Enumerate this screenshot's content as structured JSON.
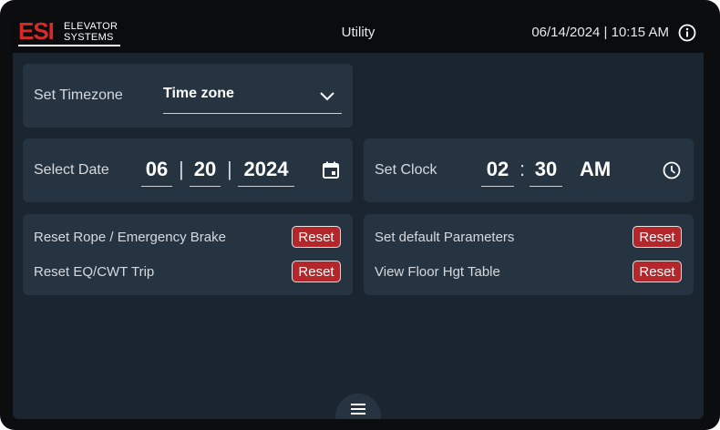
{
  "header": {
    "logo_main": "ESI",
    "logo_line1": "ELEVATOR",
    "logo_line2": "SYSTEMS",
    "title": "Utility",
    "datetime": "06/14/2024 | 10:15 AM",
    "info_icon": "info-icon"
  },
  "timezone": {
    "label": "Set Timezone",
    "value": "Time zone",
    "dropdown_icon": "chevron-down-icon"
  },
  "date": {
    "label": "Select Date",
    "month": "06",
    "day": "20",
    "year": "2024",
    "separator": "|",
    "icon": "calendar-icon"
  },
  "clock": {
    "label": "Set Clock",
    "hour": "02",
    "minute": "30",
    "separator": ":",
    "period": "AM",
    "icon": "clock-icon"
  },
  "resets_left": [
    {
      "label": "Reset Rope / Emergency Brake",
      "button": "Reset"
    },
    {
      "label": "Reset EQ/CWT Trip",
      "button": "Reset"
    }
  ],
  "resets_right": [
    {
      "label": "Set default Parameters",
      "button": "Reset"
    },
    {
      "label": "View Floor Hgt Table",
      "button": "Reset"
    }
  ],
  "menu": {
    "icon": "hamburger-menu-icon"
  },
  "colors": {
    "brand_red": "#d42a2a",
    "reset_button": "#b3262a",
    "card": "#263442",
    "screen_bg": "#1a2530",
    "topbar": "#0b0c0e"
  }
}
